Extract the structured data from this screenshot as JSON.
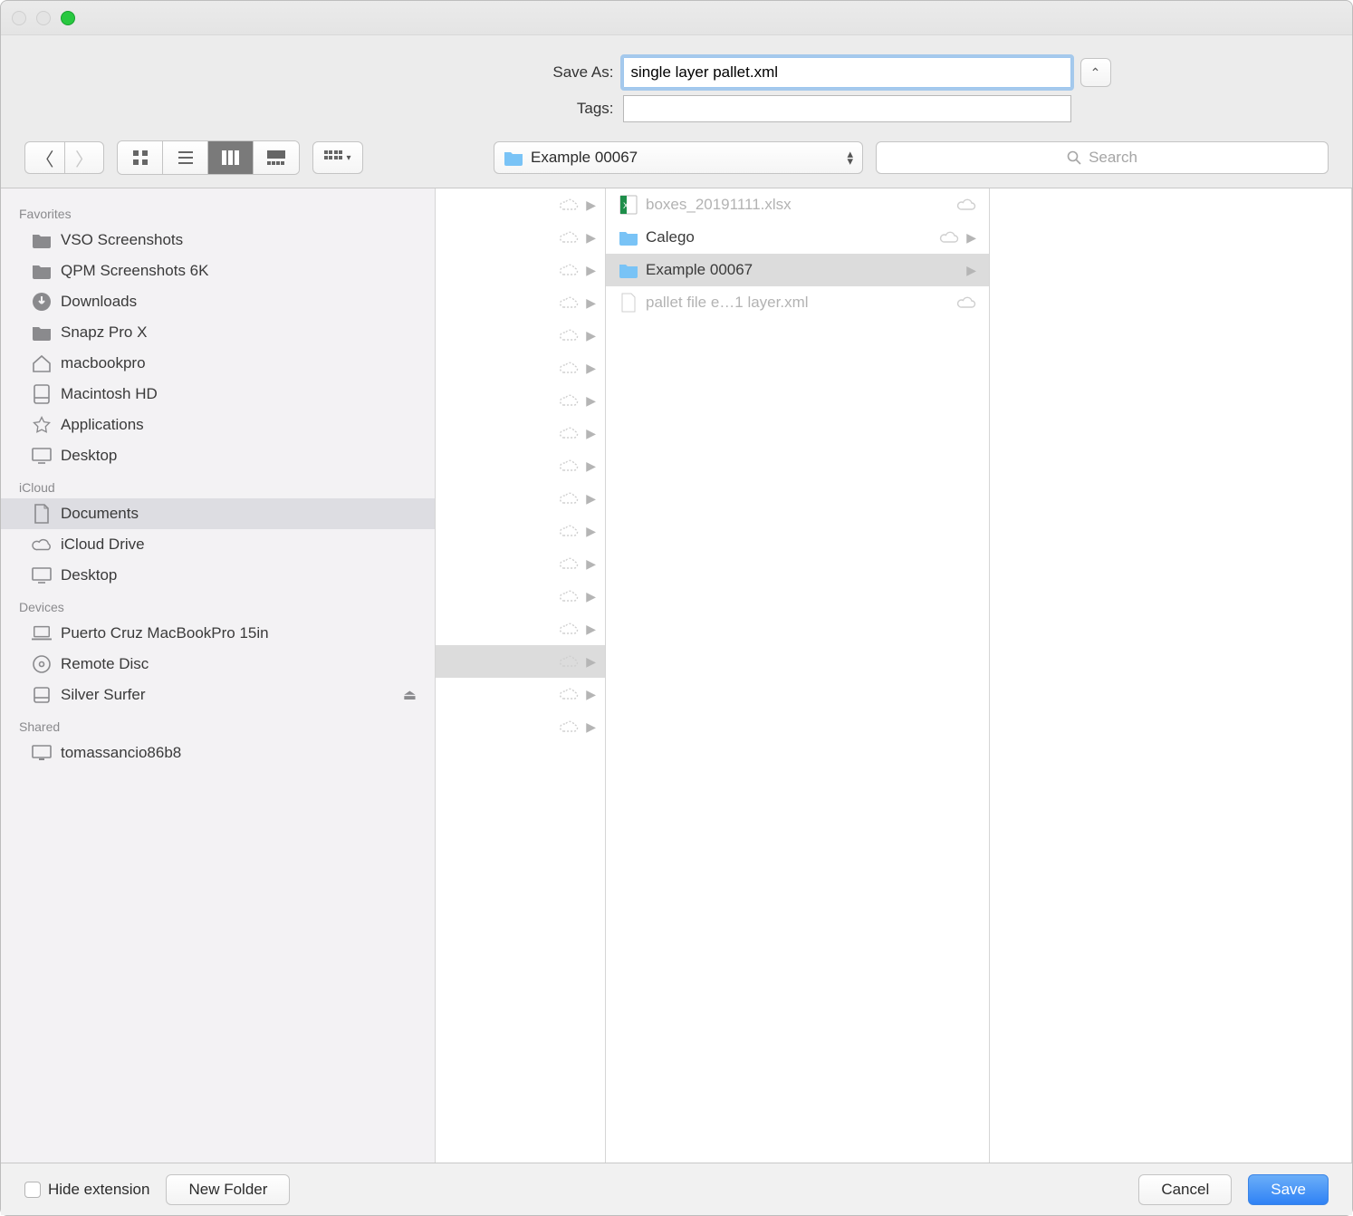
{
  "header": {
    "save_as_label": "Save As:",
    "save_as_value": "single layer pallet.xml",
    "tags_label": "Tags:",
    "tags_value": ""
  },
  "toolbar": {
    "location": "Example 00067",
    "search_placeholder": "Search"
  },
  "traffic_colors": {
    "close": "#e4e4e4",
    "min": "#e4e4e4",
    "zoom": "#28c840"
  },
  "sidebar": {
    "sections": [
      {
        "title": "Favorites",
        "items": [
          {
            "icon": "folder",
            "label": "VSO Screenshots"
          },
          {
            "icon": "folder",
            "label": "QPM Screenshots 6K"
          },
          {
            "icon": "download",
            "label": "Downloads"
          },
          {
            "icon": "folder",
            "label": "Snapz Pro X"
          },
          {
            "icon": "home",
            "label": "macbookpro"
          },
          {
            "icon": "hdd",
            "label": "Macintosh HD"
          },
          {
            "icon": "app",
            "label": "Applications"
          },
          {
            "icon": "desktop",
            "label": "Desktop"
          }
        ]
      },
      {
        "title": "iCloud",
        "items": [
          {
            "icon": "doc",
            "label": "Documents",
            "selected": true
          },
          {
            "icon": "cloud",
            "label": "iCloud Drive"
          },
          {
            "icon": "desktop",
            "label": "Desktop"
          }
        ]
      },
      {
        "title": "Devices",
        "items": [
          {
            "icon": "laptop",
            "label": "Puerto Cruz MacBookPro 15in"
          },
          {
            "icon": "disc",
            "label": "Remote Disc"
          },
          {
            "icon": "ext",
            "label": "Silver Surfer",
            "eject": true
          }
        ]
      },
      {
        "title": "Shared",
        "items": [
          {
            "icon": "mon",
            "label": "tomassancio86b8"
          }
        ]
      }
    ]
  },
  "column1_rows": 17,
  "column1_selected_index": 14,
  "column2": [
    {
      "type": "file",
      "icon": "xlsx",
      "label": "boxes_20191111.xlsx",
      "cloud": true,
      "dim": true
    },
    {
      "type": "folder",
      "label": "Calego",
      "cloud": true,
      "arrow": true
    },
    {
      "type": "folder",
      "label": "Example 00067",
      "arrow": true,
      "selected": true
    },
    {
      "type": "file",
      "icon": "blank",
      "label": "pallet file e…1 layer.xml",
      "cloud": true,
      "dim": true
    }
  ],
  "footer": {
    "hide_ext_label": "Hide extension",
    "new_folder_label": "New Folder",
    "cancel_label": "Cancel",
    "save_label": "Save"
  }
}
